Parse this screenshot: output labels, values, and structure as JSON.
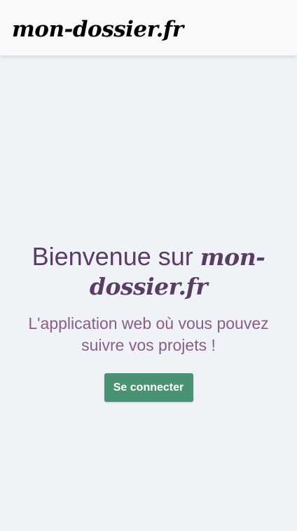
{
  "header": {
    "brand": "mon-dossier.fr"
  },
  "hero": {
    "title_prefix": "Bienvenue sur",
    "title_brand": "mon-dossier.fr",
    "subtitle": "L'application web où vous pouvez suivre vos projets !",
    "login_label": "Se connecter"
  },
  "colors": {
    "page_background": "#eff2f6",
    "header_background": "#f8f9fb",
    "title_color": "#5a3d63",
    "subtitle_color": "#8a5e85",
    "button_color": "#4b9272"
  }
}
